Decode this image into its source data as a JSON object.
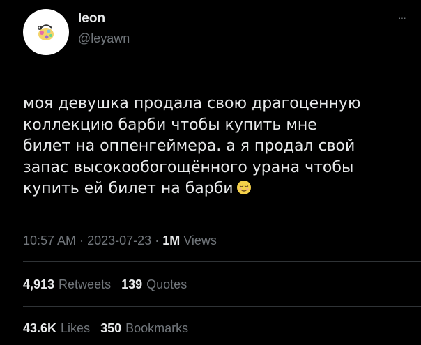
{
  "author": {
    "display_name": "leon",
    "handle": "@leyawn"
  },
  "more_icon_glyph": "···",
  "tweet": {
    "text": "моя девушка продала свою драгоценную\nколлекцию барби чтобы купить мне\nбилет на оппенгеймера. а я продал свой\nзапас высокообогощённого урана чтобы\nкупить ей билет на барби",
    "emoji": "relieved-face-emoji"
  },
  "meta": {
    "time": "10:57 AM",
    "separator": "·",
    "date": "2023-07-23",
    "views_count": "1M",
    "views_label": "Views"
  },
  "stats": {
    "retweets_count": "4,913",
    "retweets_label": "Retweets",
    "quotes_count": "139",
    "quotes_label": "Quotes",
    "likes_count": "43.6K",
    "likes_label": "Likes",
    "bookmarks_count": "350",
    "bookmarks_label": "Bookmarks"
  },
  "colors": {
    "background": "#000000",
    "text_primary": "#e7e9ea",
    "text_secondary": "#71767b",
    "divider": "#2f3336"
  }
}
